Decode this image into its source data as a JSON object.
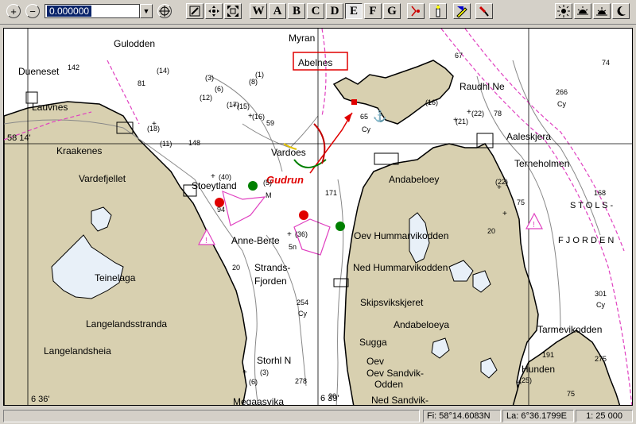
{
  "toolbar": {
    "zoom_in": "+",
    "zoom_out": "−",
    "scale_value": "0.000000",
    "letter_buttons": [
      "W",
      "A",
      "B",
      "C",
      "D",
      "E",
      "F",
      "G"
    ]
  },
  "map": {
    "labels": {
      "gulodden": "Gulodden",
      "myran": "Myran",
      "abelnes": "Abelnes",
      "dueneset": "Dueneset",
      "lauvnes": "Lauvnes",
      "raudhl": "Raudhl Ne",
      "aaleskjera": "Aaleskjera",
      "terneholmen": "Terneholmen",
      "kraakenes": "Kraakenes",
      "vardefjellet": "Vardefjellet",
      "stoeytland": "Stoeytland",
      "gudrun": "Gudrun",
      "vardoes": "Vardoes",
      "andabeloey": "Andabeloey",
      "stols": "S T O L S -",
      "fjorden": "F J O R D E N",
      "anne_berte": "Anne-Berte",
      "oev_hummarvik": "Oev Hummarvikodden",
      "ned_hummarvik": "Ned Hummarvikodden",
      "strands": "Strands-",
      "fjorden2": "Fjorden",
      "teinelaga": "Teinelaga",
      "skipsvik": "Skipsvikskjeret",
      "langelandsstranda": "Langelandsstranda",
      "andabeloeya": "Andabeloeya",
      "tarmevik": "Tarmevikodden",
      "langelandsheia": "Langelandsheia",
      "sugga": "Sugga",
      "storhl": "Storhl N",
      "hunden": "Hunden",
      "oev_sandvik1": "Oev Sandvik-",
      "oev_sandvik2": "Odden",
      "oev": "Oev",
      "ned_sandvik": "Ned Sandvik-",
      "megaasvika": "Megaasvika",
      "lat_label": "58 14'",
      "lon_label": "6 36'",
      "lon_label2": "6 39'"
    },
    "soundings": {
      "s142": "142",
      "s81": "81",
      "s14": "(14)",
      "s6": "(6)",
      "s3": "(3)",
      "s1": "(1)",
      "s8": "(8)",
      "s15": "(15)",
      "s16": "(16)",
      "s59": "59",
      "s18": "(18)",
      "s11": "(11)",
      "s148": "148",
      "s40": "(40)",
      "s94": "94",
      "s5": "(5)",
      "s171": "171",
      "s36": "(36)",
      "s5n": "5n",
      "s254": "254",
      "scy": "Cy",
      "s65": "65",
      "scy2": "Cy",
      "s67": "67",
      "s74": "74",
      "s266": "266",
      "scy3": "Cy",
      "s22": "(22)",
      "s78": "78",
      "s21": "(21)",
      "s168": "168",
      "s75": "75",
      "s301": "301",
      "scy4": "Cy",
      "s191": "191",
      "s275": "275",
      "s278": "278",
      "s20": "20",
      "s75b": "75",
      "s3b": "(3)",
      "s17": "(17)",
      "s12": "(12)",
      "s16b": "(16)",
      "s22b": "(22)",
      "sm": "M",
      "s20b": "20",
      "s20c": "20",
      "s6b": "(6)",
      "s25": "(25)"
    }
  },
  "status": {
    "lat": "Fi: 58°14.6083N",
    "lon": "La: 6°36.1799E",
    "scale": "1: 25 000"
  }
}
